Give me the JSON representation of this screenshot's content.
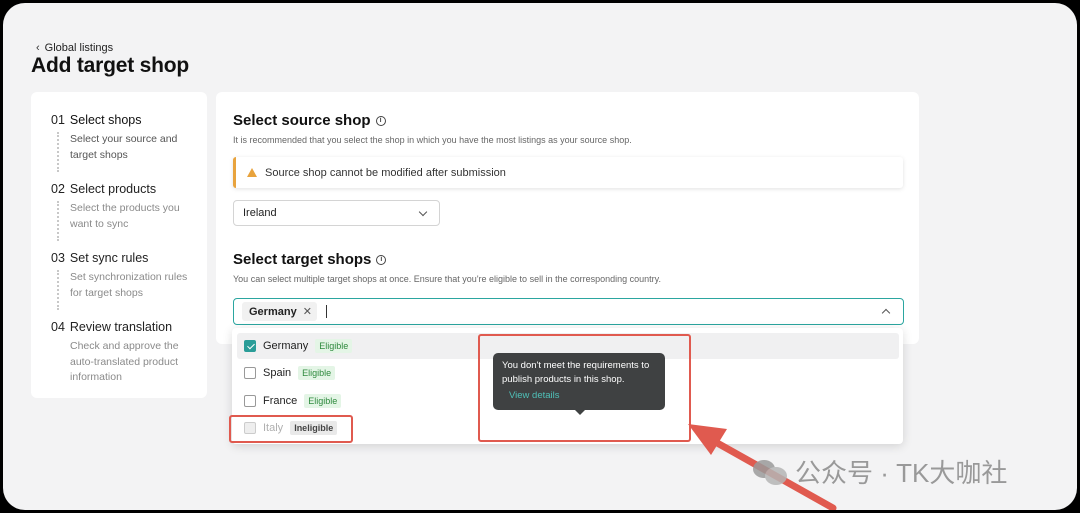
{
  "header": {
    "back_label": "Global listings",
    "page_title": "Add target shop"
  },
  "steps": [
    {
      "num": "01",
      "title": "Select shops",
      "desc": "Select your source and target shops"
    },
    {
      "num": "02",
      "title": "Select products",
      "desc": "Select the products you want to sync"
    },
    {
      "num": "03",
      "title": "Set sync rules",
      "desc": "Set synchronization rules for target shops"
    },
    {
      "num": "04",
      "title": "Review translation",
      "desc": "Check and approve the auto-translated product information"
    }
  ],
  "source": {
    "heading": "Select source shop",
    "subtitle": "It is recommended that you select the shop in which you have the most listings as your source shop.",
    "warning": "Source shop cannot be modified after submission",
    "selected": "Ireland"
  },
  "target": {
    "heading": "Select target shops",
    "subtitle": "You can select multiple target shops at once. Ensure that you're eligible to sell in the corresponding country.",
    "selected_tag": "Germany",
    "options": [
      {
        "label": "Germany",
        "badge": "Eligible",
        "checked": true,
        "eligible": true
      },
      {
        "label": "Spain",
        "badge": "Eligible",
        "checked": false,
        "eligible": true
      },
      {
        "label": "France",
        "badge": "Eligible",
        "checked": false,
        "eligible": true
      },
      {
        "label": "Italy",
        "badge": "Ineligible",
        "checked": false,
        "eligible": false
      }
    ]
  },
  "tooltip": {
    "text": "You don't meet the requirements to publish products in this shop.",
    "link": "View details"
  },
  "watermark": {
    "text": "公众号 · TK大咖社"
  },
  "colors": {
    "accent": "#2a9d98",
    "warning": "#e8a33d",
    "annotation_red": "#e05a4f",
    "eligible_bg": "#e4f5e6",
    "eligible_text": "#2f8a3e"
  }
}
